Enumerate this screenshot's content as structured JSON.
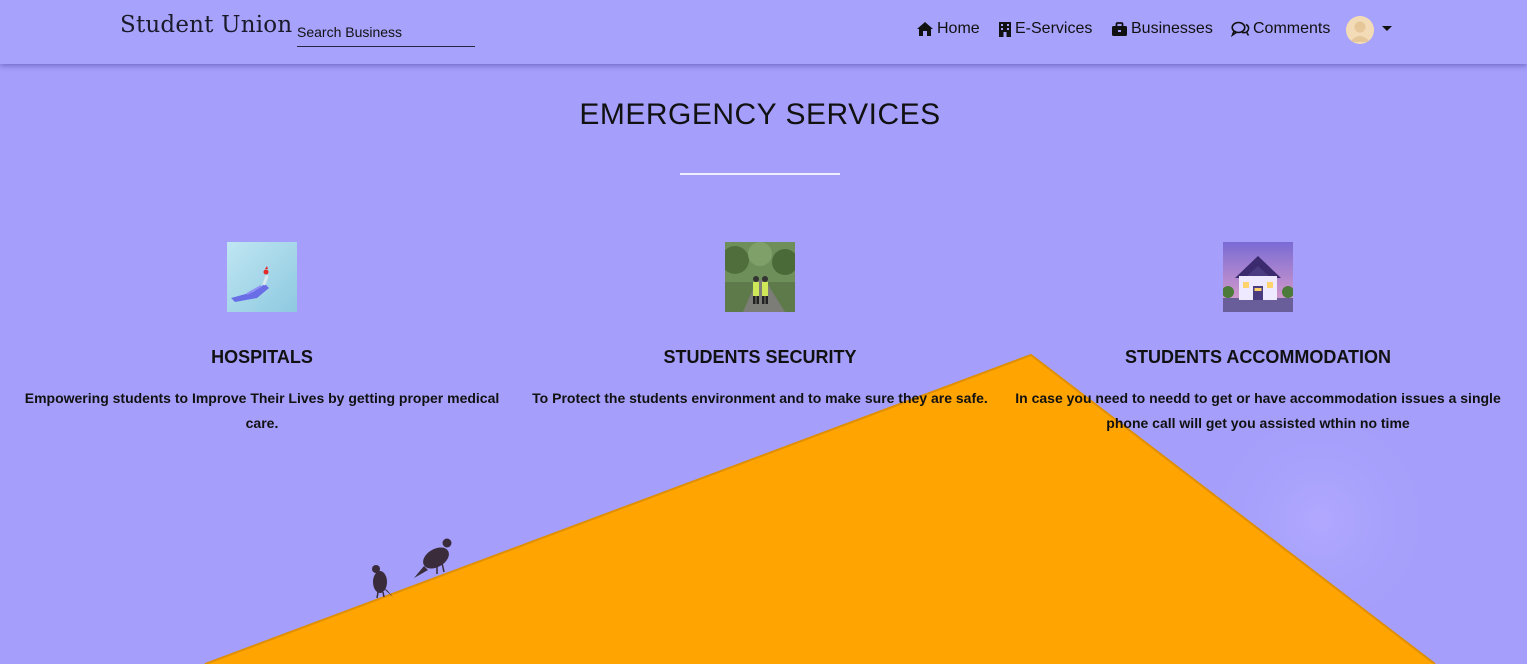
{
  "navbar": {
    "brand": "Student Union",
    "search_placeholder": "Search Business",
    "items": [
      {
        "label": "Home",
        "icon": "home-icon"
      },
      {
        "label": "E-Services",
        "icon": "building-icon"
      },
      {
        "label": "Businesses",
        "icon": "briefcase-icon"
      },
      {
        "label": "Comments",
        "icon": "comments-icon"
      }
    ],
    "profile_icon": "avatar-icon"
  },
  "main": {
    "title": "EMERGENCY SERVICES",
    "services": [
      {
        "title": "HOSPITALS",
        "description": "Empowering students to Improve Their Lives by getting proper medical care.",
        "image": "hospital-image"
      },
      {
        "title": "STUDENTS SECURITY",
        "description": "To Protect the students environment and to make sure they are safe.",
        "image": "security-image"
      },
      {
        "title": "STUDENTS ACCOMMODATION",
        "description": "In case you need to needd to get or have accommodation issues a single phone call will get you assisted wthin no time",
        "image": "house-image"
      }
    ]
  },
  "colors": {
    "sky": "#a59ffb",
    "navbar": "#a7a2fc",
    "roof": "#ffa400"
  }
}
